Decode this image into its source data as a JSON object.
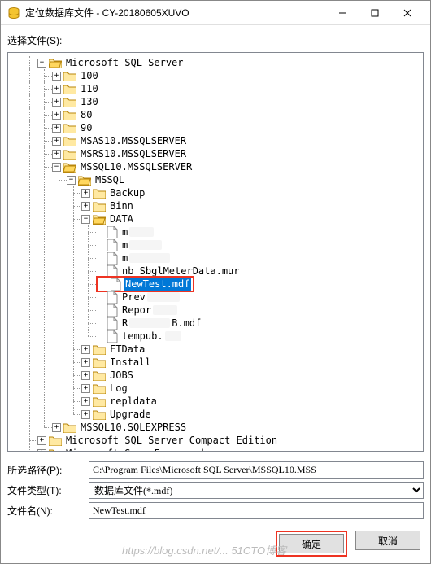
{
  "titlebar": {
    "icon": "database-icon",
    "title": "定位数据库文件 - CY-20180605XUVO"
  },
  "select_label": "选择文件(S):",
  "tree": {
    "root": "Microsoft SQL Server",
    "folders_l1": [
      "100",
      "110",
      "130",
      "80",
      "90",
      "MSAS10.MSSQLSERVER",
      "MSRS10.MSSQLSERVER",
      "MSSQL10.MSSQLSERVER"
    ],
    "mssql": "MSSQL",
    "mssql_children": [
      "Backup",
      "Binn"
    ],
    "data": "DATA",
    "files": [
      {
        "label": "m",
        "smudge": 30
      },
      {
        "label": "m",
        "smudge": 40
      },
      {
        "label": "m",
        "smudge": 50
      },
      {
        "label": "nb_SbglMeterData.mur"
      },
      {
        "label": "NewTest.mdf",
        "selected": true,
        "highlighted": true
      },
      {
        "label": "Prev",
        "smudge": 40
      },
      {
        "label": "Repor",
        "smudge": 30
      },
      {
        "label": "R",
        "smudge": 50,
        "suffix": "B.mdf"
      },
      {
        "label": "tempub.",
        "smudge": 20
      }
    ],
    "mssql_after": [
      "FTData",
      "Install",
      "JOBS",
      "Log",
      "repldata",
      "Upgrade"
    ],
    "after_mssql10": [
      "MSSQL10.SQLEXPRESS"
    ],
    "root_siblings": [
      "Microsoft SQL Server Compact Edition",
      "Microsoft Sync Framework"
    ]
  },
  "form": {
    "path_label": "所选路径(P):",
    "path_value": "C:\\Program Files\\Microsoft SQL Server\\MSSQL10.MSS",
    "filetype_label": "文件类型(T):",
    "filetype_value": "数据库文件(*.mdf)",
    "filename_label": "文件名(N):",
    "filename_value": "NewTest.mdf"
  },
  "buttons": {
    "ok": "确定",
    "cancel": "取消"
  },
  "watermark": "https://blog.csdn.net/... 51CTO博客"
}
